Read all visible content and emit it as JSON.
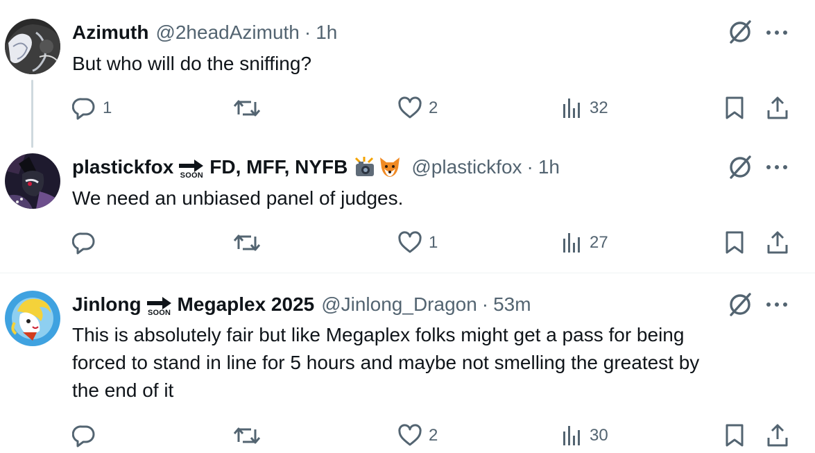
{
  "tweets": [
    {
      "name": "Azimuth",
      "name_suffix": "",
      "handle": "@2headAzimuth",
      "separator": "·",
      "time": "1h",
      "text": "But who will do the sniffing?",
      "stats": {
        "replies": "1",
        "reposts": "",
        "likes": "2",
        "views": "32"
      }
    },
    {
      "name": "plastickfox",
      "soon_label": "SOON",
      "name_suffix": "FD, MFF, NYFB",
      "handle": "@plastickfox",
      "separator": "·",
      "time": "1h",
      "text": "We need an unbiased panel of judges.",
      "stats": {
        "replies": "",
        "reposts": "",
        "likes": "1",
        "views": "27"
      }
    },
    {
      "name": "Jinlong",
      "soon_label": "SOON",
      "name_suffix": "Megaplex 2025",
      "handle": "@Jinlong_Dragon",
      "separator": "·",
      "time": "53m",
      "text_lines": [
        "This is absolutely fair but like Megaplex folks might get a pass for being",
        "forced to stand in line for 5 hours and maybe not smelling the greatest by",
        "the end of it"
      ],
      "stats": {
        "replies": "",
        "reposts": "",
        "likes": "2",
        "views": "30"
      }
    }
  ],
  "colors": {
    "text": "#0f1419",
    "secondary": "#536471",
    "divider": "#eff3f4",
    "thread_line": "#cfd9de"
  },
  "icons": [
    "reply-icon",
    "repost-icon",
    "like-icon",
    "views-icon",
    "bookmark-icon",
    "share-icon",
    "grok-icon",
    "more-icon",
    "soon-arrow-icon",
    "camera-flash-emoji",
    "fox-emoji"
  ]
}
